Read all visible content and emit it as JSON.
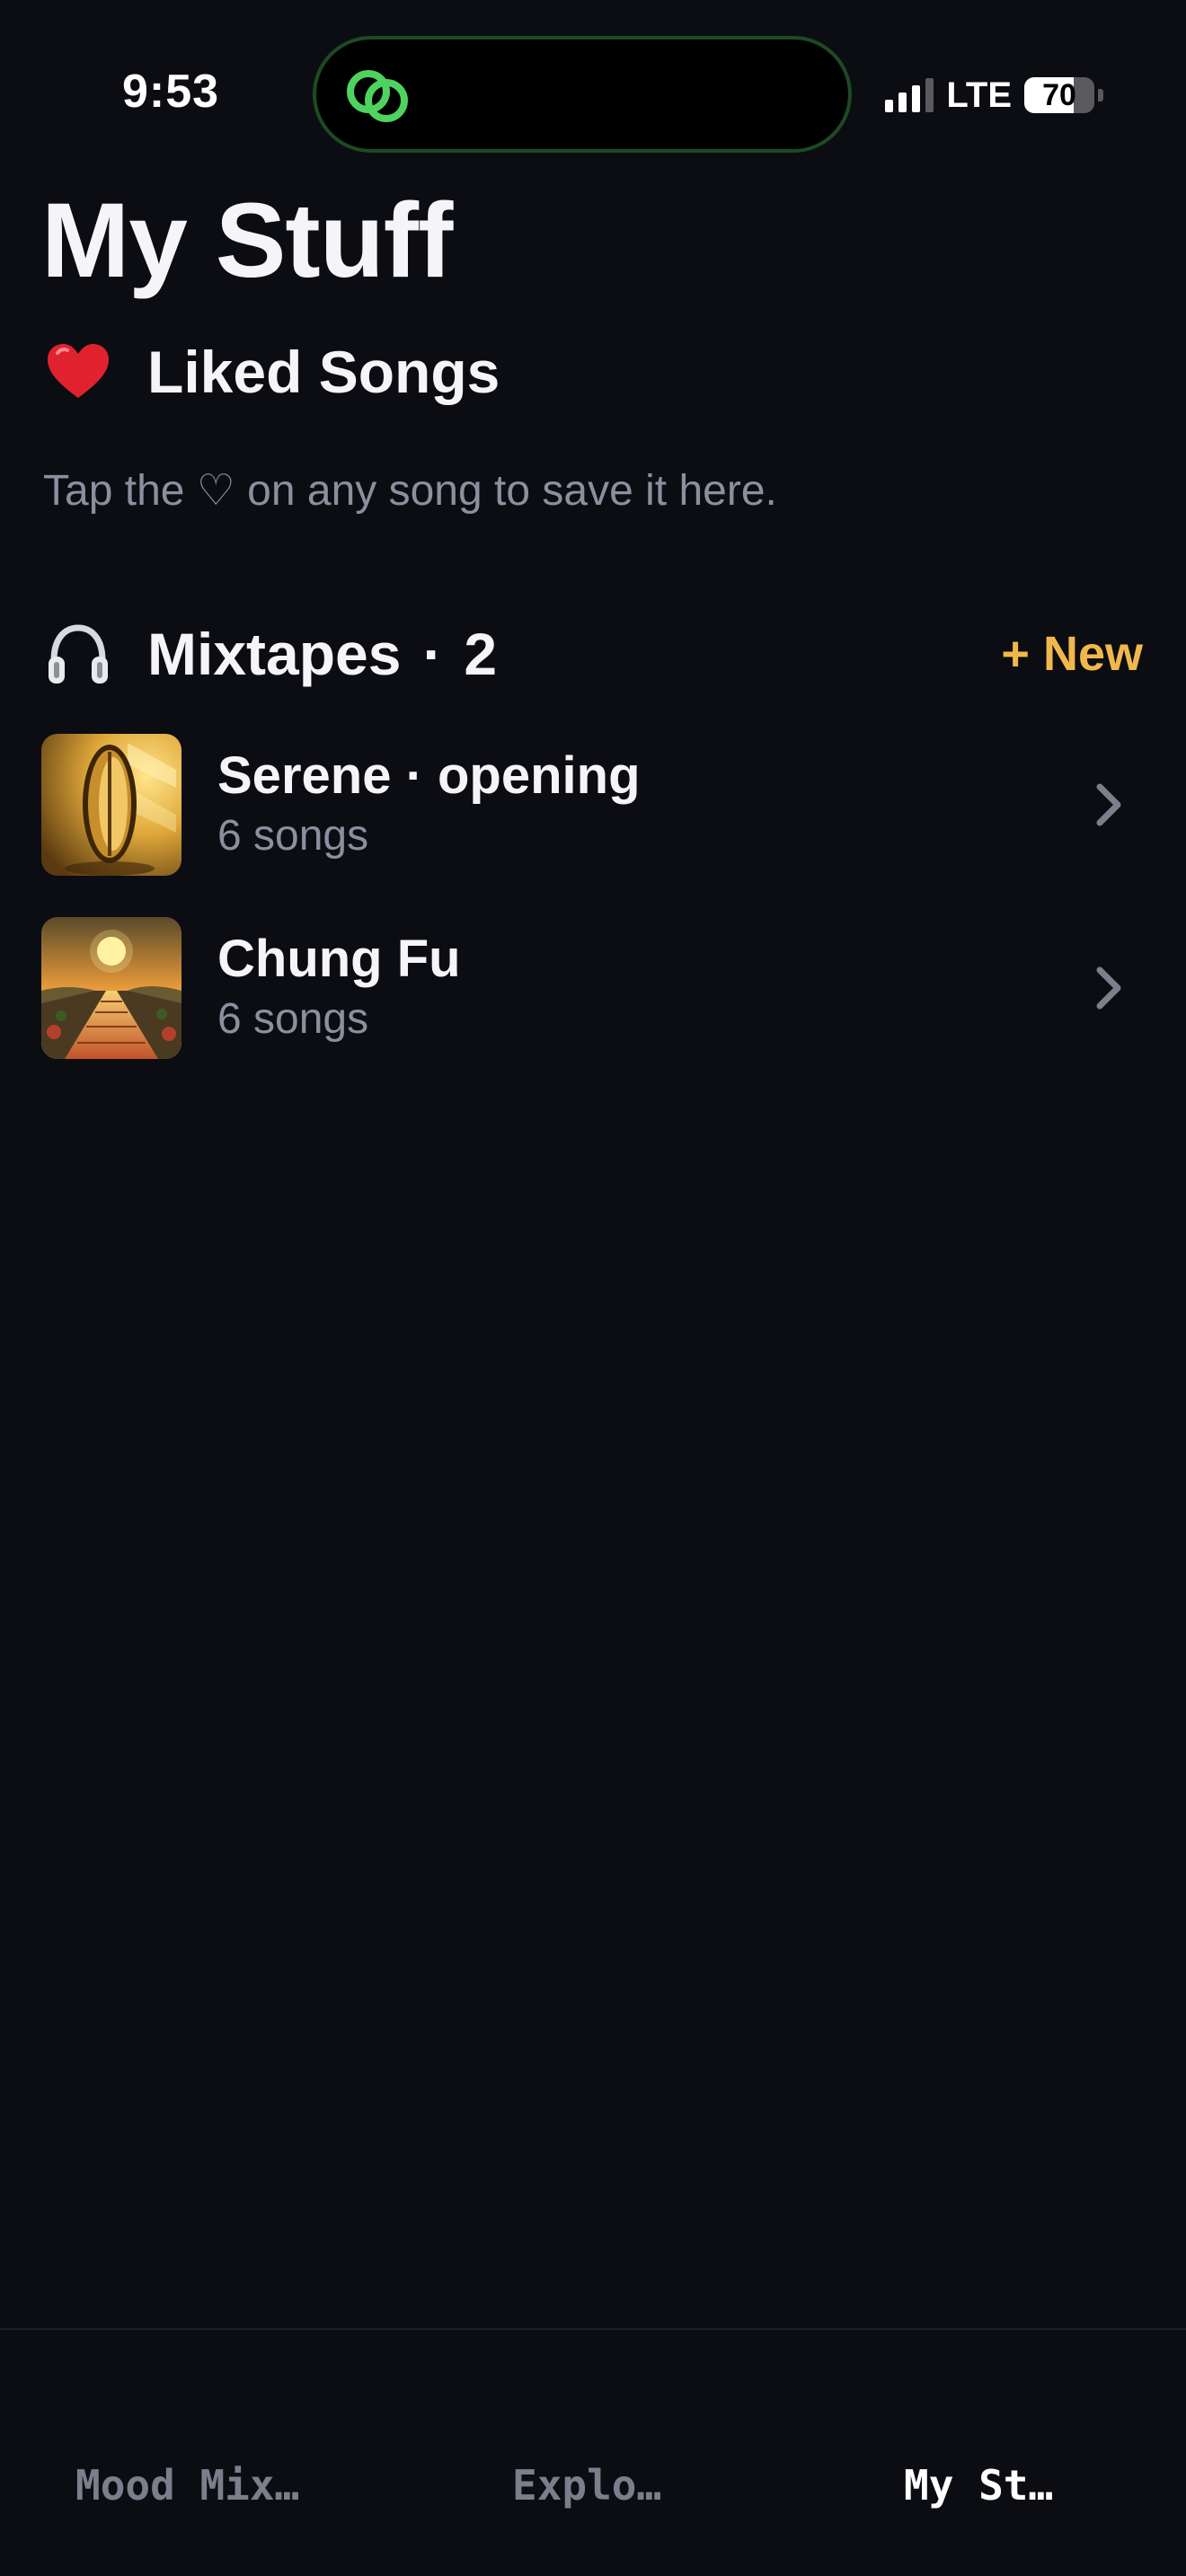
{
  "status_bar": {
    "time": "9:53",
    "network": "LTE",
    "battery": "70",
    "battery_level_percent": 70,
    "island_icon": "linked-rings-icon",
    "island_icon_color": "#4fd35f"
  },
  "page": {
    "title": "My Stuff"
  },
  "liked_songs": {
    "icon": "red-heart-icon",
    "title": "Liked Songs",
    "hint": "Tap the ♡ on any song to save it here."
  },
  "mixtapes": {
    "icon": "headphones-icon",
    "title": "Mixtapes",
    "separator": "·",
    "count": "2",
    "new_label": "+ New",
    "accent_color": "#f0b84c",
    "items": [
      {
        "name": "Serene · opening",
        "subtitle": "6 songs",
        "artwork": "sunlit-window-artwork"
      },
      {
        "name": "Chung Fu",
        "subtitle": "6 songs",
        "artwork": "sunset-road-artwork"
      }
    ]
  },
  "tab_bar": {
    "tabs": [
      {
        "label": "Mood Mix…",
        "active": false
      },
      {
        "label": "Explo…",
        "active": false
      },
      {
        "label": "My St…",
        "active": true
      }
    ]
  }
}
